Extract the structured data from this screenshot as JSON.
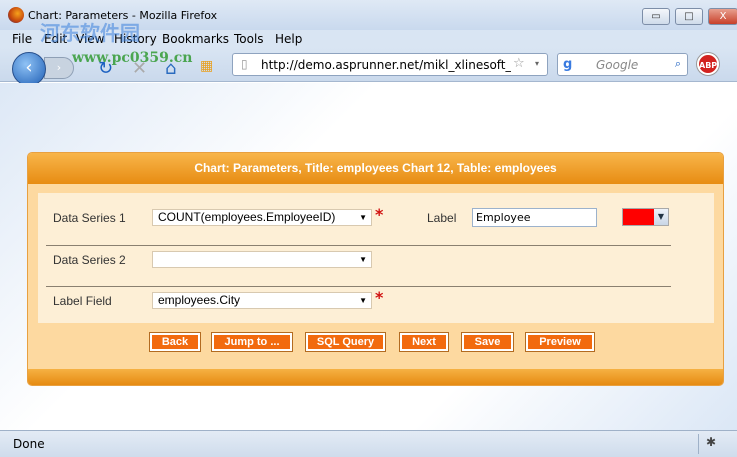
{
  "window": {
    "title": "Chart: Parameters - Mozilla Firefox",
    "minimize": "▭",
    "maximize": "□",
    "close": "X"
  },
  "menu": [
    "File",
    "Edit",
    "View",
    "History",
    "Bookmarks",
    "Tools",
    "Help"
  ],
  "toolbar": {
    "url": "http://demo.asprunner.net/mikl_xlinesoft_com",
    "search_placeholder": "Google",
    "abp": "ABP"
  },
  "watermark": {
    "cn": "河东软件园",
    "url": "www.pc0359.cn"
  },
  "panel": {
    "title": "Chart: Parameters, Title: employees Chart 12, Table: employees",
    "data_series_1": {
      "label": "Data Series 1",
      "value": "COUNT(employees.EmployeeID)",
      "required": "*",
      "label_label": "Label",
      "label_value": "Employee",
      "color": "#ff0000"
    },
    "data_series_2": {
      "label": "Data Series 2",
      "value": ""
    },
    "label_field": {
      "label": "Label Field",
      "value": "employees.City",
      "required": "*"
    },
    "buttons": [
      "Back",
      "Jump to ...",
      "SQL Query",
      "Next",
      "Save",
      "Preview"
    ]
  },
  "status": "Done"
}
